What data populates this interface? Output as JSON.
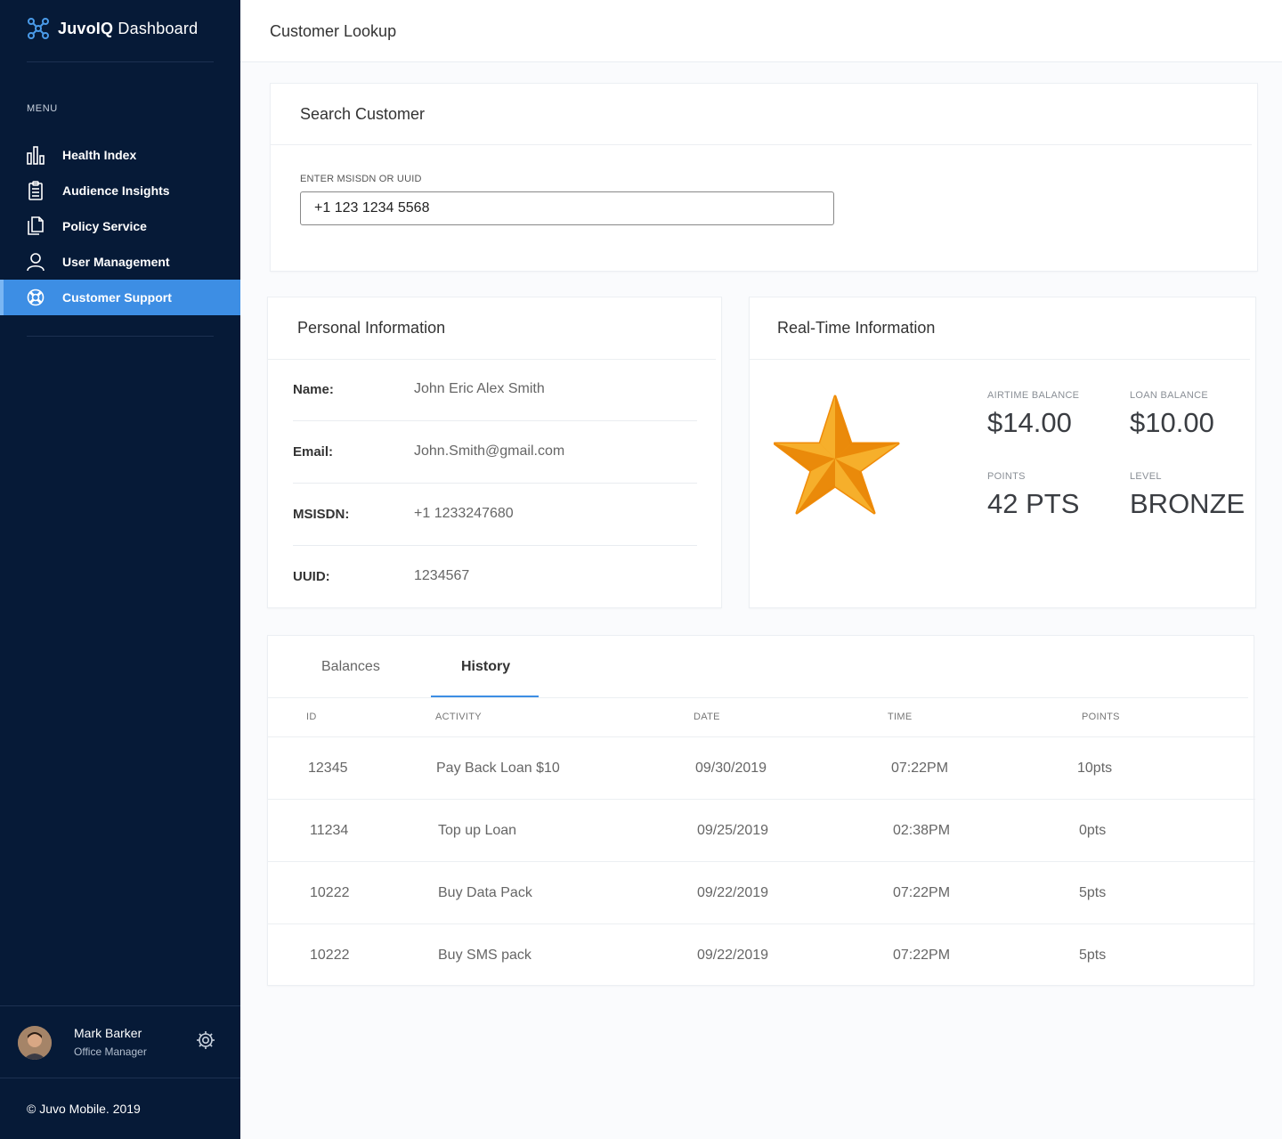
{
  "app": {
    "brand_bold": "JuvoIQ",
    "brand_rest": "Dashboard",
    "accent": "#3d8ee4",
    "sidebar_bg": "#061a37"
  },
  "sidebar": {
    "menu_label": "MENU",
    "items": [
      {
        "label": "Health Index",
        "icon": "bar-chart-icon"
      },
      {
        "label": "Audience Insights",
        "icon": "clipboard-icon"
      },
      {
        "label": "Policy Service",
        "icon": "documents-icon"
      },
      {
        "label": "User Management",
        "icon": "user-icon"
      },
      {
        "label": "Customer Support",
        "icon": "lifebuoy-icon",
        "active": true
      }
    ],
    "user": {
      "name": "Mark Barker",
      "role": "Office Manager"
    },
    "copyright": "© Juvo Mobile. 2019"
  },
  "header": {
    "title": "Customer Lookup"
  },
  "search": {
    "title": "Search Customer",
    "field_label": "ENTER MSISDN OR UUID",
    "value": "+1 123 1234 5568"
  },
  "personal": {
    "title": "Personal Information",
    "rows": [
      {
        "key": "Name:",
        "value": "John Eric Alex Smith"
      },
      {
        "key": "Email:",
        "value": "John.Smith@gmail.com"
      },
      {
        "key": "MSISDN:",
        "value": "+1 1233247680"
      },
      {
        "key": "UUID:",
        "value": "1234567"
      }
    ]
  },
  "realtime": {
    "title": "Real-Time Information",
    "star_color": "#f5a10f",
    "airtime_label": "AIRTIME BALANCE",
    "airtime_value": "$14.00",
    "loan_label": "LOAN BALANCE",
    "loan_value": "$10.00",
    "points_label": "POINTS",
    "points_value": "42 PTS",
    "level_label": "LEVEL",
    "level_value": "BRONZE"
  },
  "history": {
    "tabs": [
      "Balances",
      "History"
    ],
    "active_tab": "History",
    "columns": [
      "ID",
      "ACTIVITY",
      "DATE",
      "TIME",
      "POINTS"
    ],
    "rows": [
      {
        "id": "12345",
        "activity": "Pay Back Loan $10",
        "date": "09/30/2019",
        "time": "07:22PM",
        "points": "10pts"
      },
      {
        "id": "11234",
        "activity": "Top up Loan",
        "date": "09/25/2019",
        "time": "02:38PM",
        "points": "0pts"
      },
      {
        "id": "10222",
        "activity": "Buy Data Pack",
        "date": "09/22/2019",
        "time": "07:22PM",
        "points": "5pts"
      },
      {
        "id": "10222",
        "activity": "Buy SMS pack",
        "date": "09/22/2019",
        "time": "07:22PM",
        "points": "5pts"
      }
    ]
  }
}
